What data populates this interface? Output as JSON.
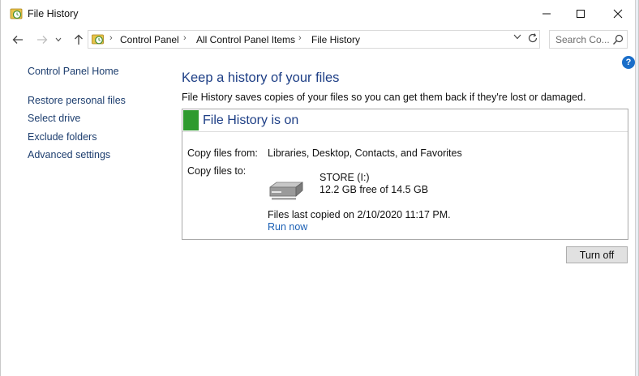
{
  "window": {
    "title": "File History",
    "controls": {
      "minimize": "minimize",
      "maximize": "maximize",
      "close": "close"
    }
  },
  "address_bar": {
    "crumbs": [
      "Control Panel",
      "All Control Panel Items",
      "File History"
    ],
    "search_placeholder": "Search Co..."
  },
  "left_nav": {
    "home": "Control Panel Home",
    "links": [
      "Restore personal files",
      "Select drive",
      "Exclude folders",
      "Advanced settings"
    ]
  },
  "main": {
    "title": "Keep a history of your files",
    "description": "File History saves copies of your files so you can get them back if they're lost or damaged.",
    "status": "File History is on",
    "status_color": "#2e9a2e",
    "copy_from_label": "Copy files from:",
    "copy_from_value": "Libraries, Desktop, Contacts, and Favorites",
    "copy_to_label": "Copy files to:",
    "drive_name": "STORE (I:)",
    "drive_free": "12.2 GB free of 14.5 GB",
    "last_copied": "Files last copied on 2/10/2020 11:17 PM.",
    "run_now": "Run now",
    "turn_off": "Turn off"
  },
  "icons": {
    "app": "file-history-icon",
    "help": "help-icon",
    "drive": "drive-icon"
  }
}
